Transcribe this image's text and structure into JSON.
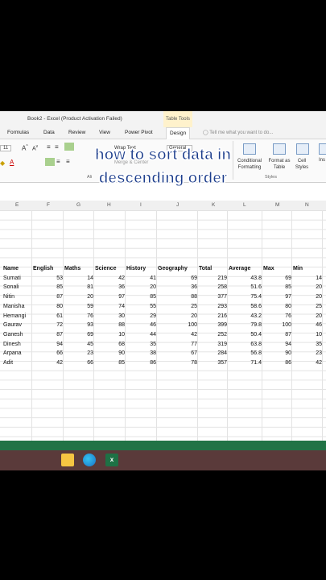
{
  "window": {
    "title": "Book2 - Excel (Product Activation Failed)",
    "table_tools": "Table Tools"
  },
  "menu": {
    "items": [
      "Formulas",
      "Data",
      "Review",
      "View",
      "Power Pivot",
      "Design"
    ],
    "tell_me": "Tell me what you want to do..."
  },
  "ribbon": {
    "font_size": "11",
    "wrap_text": "Wrap Text",
    "merge_center": "Merge & Center",
    "number_format": "General",
    "conditional_formatting": "Conditional Formatting",
    "format_as_table": "Format as Table",
    "cell_styles": "Cell Styles",
    "insert": "Ins",
    "styles_group": "Styles",
    "alignment_group": "Ali"
  },
  "overlay": {
    "line1": "how to sort data in",
    "line2": "descending order"
  },
  "sheet": {
    "columns": [
      "E",
      "F",
      "G",
      "H",
      "I",
      "J",
      "K",
      "L",
      "M",
      "N"
    ],
    "headers": [
      "Name",
      "English",
      "Maths",
      "Science",
      "History",
      "Geography",
      "Total",
      "Average",
      "Max",
      "Min"
    ],
    "rows": [
      [
        "Sumati",
        "53",
        "14",
        "42",
        "41",
        "69",
        "219",
        "43.8",
        "69",
        "14"
      ],
      [
        "Sonali",
        "85",
        "81",
        "36",
        "20",
        "36",
        "258",
        "51.6",
        "85",
        "20"
      ],
      [
        "Nitin",
        "87",
        "20",
        "97",
        "85",
        "88",
        "377",
        "75.4",
        "97",
        "20"
      ],
      [
        "Manisha",
        "80",
        "59",
        "74",
        "55",
        "25",
        "293",
        "58.6",
        "80",
        "25"
      ],
      [
        "Hemangi",
        "61",
        "76",
        "30",
        "29",
        "20",
        "216",
        "43.2",
        "76",
        "20"
      ],
      [
        "Gaurav",
        "72",
        "93",
        "88",
        "46",
        "100",
        "399",
        "79.8",
        "100",
        "46"
      ],
      [
        "Ganesh",
        "87",
        "69",
        "10",
        "44",
        "42",
        "252",
        "50.4",
        "87",
        "10"
      ],
      [
        "Dinesh",
        "94",
        "45",
        "68",
        "35",
        "77",
        "319",
        "63.8",
        "94",
        "35"
      ],
      [
        "Arpana",
        "66",
        "23",
        "90",
        "38",
        "67",
        "284",
        "56.8",
        "90",
        "23"
      ],
      [
        "Adit",
        "42",
        "66",
        "85",
        "86",
        "78",
        "357",
        "71.4",
        "86",
        "42"
      ]
    ]
  },
  "taskbar": {
    "icons": [
      "file-explorer-icon",
      "edge-icon",
      "excel-icon"
    ]
  },
  "colors": {
    "excel_green": "#217346",
    "overlay_text": "#1c3d8c"
  }
}
